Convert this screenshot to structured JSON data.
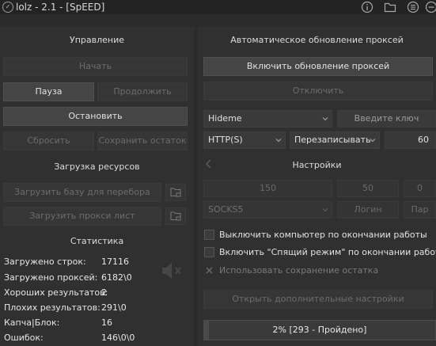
{
  "window": {
    "title": "lolz - 2.1 - [SpEED]"
  },
  "left": {
    "control": {
      "header": "Управление",
      "start_label": "Начать",
      "pause_label": "Пауза",
      "resume_label": "Продолжить",
      "stop_label": "Остановить",
      "reset_label": "Сбросить",
      "save_rest_label": "Сохранить остаток"
    },
    "resources": {
      "header": "Загрузка ресурсов",
      "load_base_label": "Загрузить базу для перебора",
      "load_proxy_label": "Загрузить прокси лист"
    },
    "stats": {
      "header": "Статистика",
      "rows": [
        {
          "label": "Загружено строк:",
          "value": "17116"
        },
        {
          "label": "Загружено проксей:",
          "value": "6182\\0"
        },
        {
          "label": "Хороших результатов:",
          "value": "2"
        },
        {
          "label": "Плохих результатов:",
          "value": "291\\0"
        },
        {
          "label": "Капча|Блок:",
          "value": "16"
        },
        {
          "label": "Ошибок:",
          "value": "146\\0\\0"
        }
      ]
    }
  },
  "right": {
    "auto_update": {
      "header": "Автоматическое обновление проксей",
      "enable_label": "Включить обновление проксей",
      "disable_label": "Отключить",
      "source_select": "Hideme",
      "key_placeholder": "Введите ключ",
      "proto_select": "HTTP(S)",
      "mode_select": "Перезаписывать",
      "interval_value": "60"
    },
    "settings": {
      "header": "Настройки",
      "threads_value": "150",
      "timeout_value": "50",
      "extra_value": "0",
      "proxy_type_select": "SOCKS5",
      "login_placeholder": "Логин",
      "password_placeholder": "Пар"
    },
    "options": [
      {
        "label": "Выключить компьютер по окончании работы",
        "checked": false
      },
      {
        "label": "Включить \"Спящий режим\" по окончании работы",
        "checked": false
      },
      {
        "label": "Использовать сохранение остатка",
        "checked": true
      }
    ],
    "more_settings_label": "Открыть дополнительные настройки",
    "progress": {
      "percent": 2,
      "text": "2% [293 - Пройдено]"
    }
  },
  "colors": {
    "background": "#2b2b2b",
    "panel": "#303030",
    "button_active": "#454545",
    "text": "#e2e2e2",
    "text_disabled": "#6c6c6c"
  },
  "icons": [
    "app-logo-icon",
    "info-icon",
    "folder-icon",
    "list-icon",
    "minimize-icon",
    "speaker-mute-icon"
  ]
}
